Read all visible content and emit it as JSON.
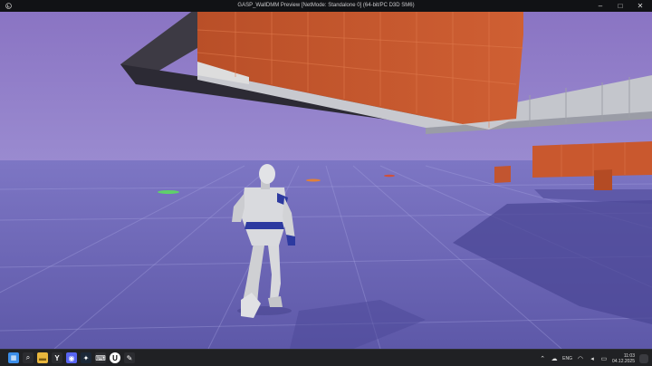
{
  "window": {
    "title": "GASP_WallDMM Preview [NetMode: Standalone 0]  (64-bit/PC D3D SM6)",
    "controls": [
      "–",
      "□",
      "✕"
    ]
  },
  "taskbar": {
    "apps": [
      {
        "name": "start",
        "icon": "windows-logo-icon",
        "glyph": "",
        "color": "#3b8eea"
      },
      {
        "name": "search",
        "icon": "search-icon",
        "glyph": "⌕",
        "color": "#2b2c30"
      },
      {
        "name": "explorer",
        "icon": "folder-icon",
        "glyph": "",
        "color": "#e8b63d"
      },
      {
        "name": "yandex",
        "icon": "yandex-browser-icon",
        "glyph": "Y",
        "color": "#2b2c30"
      },
      {
        "name": "discord",
        "icon": "discord-icon",
        "glyph": "◉",
        "color": "#5865f2"
      },
      {
        "name": "steam",
        "icon": "steam-icon",
        "glyph": "✦",
        "color": "#1b2838"
      },
      {
        "name": "ide",
        "icon": "ide-icon",
        "glyph": "⌨",
        "color": "#2b2c30"
      },
      {
        "name": "unreal",
        "icon": "unreal-engine-icon",
        "glyph": "U",
        "color": "#ffffff"
      },
      {
        "name": "editor",
        "icon": "editor-icon",
        "glyph": "✎",
        "color": "#2b2c30"
      }
    ],
    "tray": {
      "chevron": "⌃",
      "language": "ENG",
      "icons": [
        "wifi-icon",
        "speaker-icon",
        "battery-icon"
      ],
      "time": "11:03",
      "date": "04.12.2025"
    }
  },
  "scene": {
    "sky_color": "#8d7bc4",
    "floor_color": "#6a64b4",
    "wall_color": "#c9582e",
    "concrete_color": "#c8cacf"
  }
}
